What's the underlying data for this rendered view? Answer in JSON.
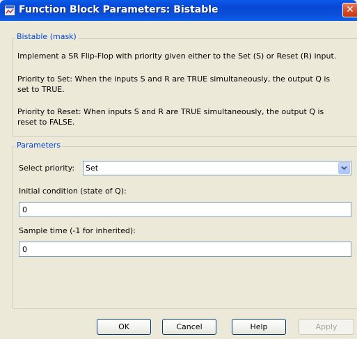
{
  "window": {
    "title": "Function Block Parameters: Bistable",
    "close_glyph": "✕"
  },
  "mask_group": {
    "legend": "Bistable (mask)",
    "description_1": "Implement a SR Flip-Flop with priority given either to the Set (S) or Reset (R) input.",
    "description_2": "Priority to Set: When the inputs S and R are TRUE simultaneously, the output Q is\nset to TRUE.",
    "description_3": "Priority to Reset: When inputs S and R are TRUE simultaneously, the output Q is\nreset to FALSE."
  },
  "parameters": {
    "legend": "Parameters",
    "priority_label": "Select priority:",
    "priority_value": "Set",
    "initial_label": "Initial condition (state of Q):",
    "initial_value": "0",
    "sample_label": "Sample time (-1 for inherited):",
    "sample_value": "0"
  },
  "buttons": {
    "ok": "OK",
    "cancel": "Cancel",
    "help": "Help",
    "apply": "Apply"
  },
  "colors": {
    "titlebar": "#0a4fd9",
    "legend_text": "#0046d5",
    "dialog_bg": "#ece9d8"
  }
}
